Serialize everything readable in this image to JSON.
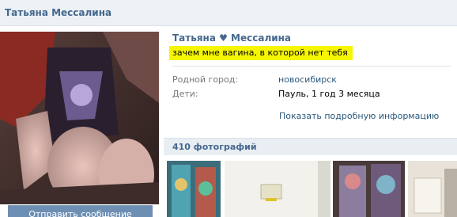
{
  "header": {
    "title": "Татьяна Мессалина"
  },
  "profile": {
    "name": "Татьяна ♥ Мессалина",
    "status": "зачем мне вагина, в которой нет тебя",
    "info": [
      {
        "label": "Родной город:",
        "value": "новосибирск"
      },
      {
        "label": "Дети:",
        "value": "Пауль, 1 год 3 месяца"
      }
    ],
    "more_link": "Показать подробную информацию",
    "send_button": "Отправить сообщение"
  },
  "photos": {
    "header": "410 фотографий"
  }
}
